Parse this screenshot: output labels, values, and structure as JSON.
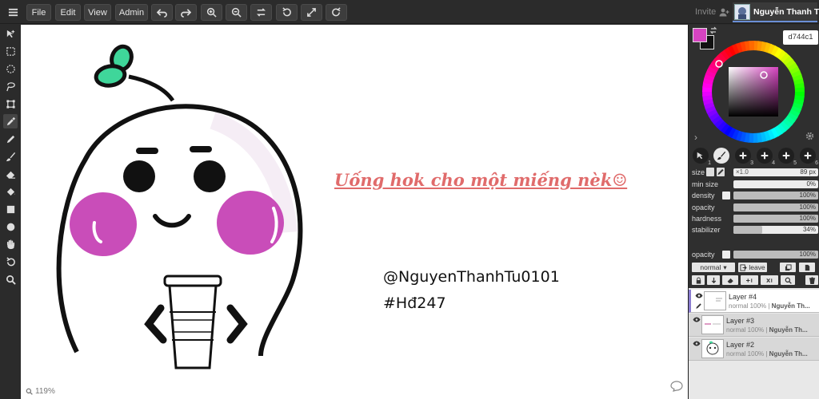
{
  "toolbar": {
    "file": "File",
    "edit": "Edit",
    "view": "View",
    "admin": "Admin"
  },
  "session": {
    "invite": "Invite",
    "user_name": "Nguyễn Thanh Tú"
  },
  "canvas": {
    "caption": "Uống hok cho một miếng nèk☺",
    "handle": "@NguyenThanhTu0101",
    "hashtag": "#Hđ247",
    "zoom": "119%",
    "colors": {
      "caption": "#e06b6b",
      "cheeks": "#c33ab1",
      "leaf": "#3fd69a"
    }
  },
  "color": {
    "primary": "#d744c1",
    "secondary": "#111111",
    "hex_label": "d744c1"
  },
  "brush_slots": [
    "1",
    "2",
    "3",
    "4",
    "5",
    "6"
  ],
  "brush": {
    "size_label": "size",
    "size_mult": "×1.0",
    "size_value": "89 px",
    "min_size_label": "min size",
    "min_size_value": "0%",
    "min_size_level": 0,
    "density_label": "density",
    "density_value": "100%",
    "density_level": 100,
    "opacity_label": "opacity",
    "opacity_value": "100%",
    "opacity_level": 100,
    "hardness_label": "hardness",
    "hardness_value": "100%",
    "hardness_level": 100,
    "stabilizer_label": "stabilizer",
    "stabilizer_value": "34%",
    "stabilizer_level": 34
  },
  "layer_controls": {
    "opacity_label": "opacity",
    "opacity_value": "100%",
    "opacity_level": 100,
    "blend_mode": "normal",
    "leave_label": "leave"
  },
  "layers": [
    {
      "name": "Layer #4",
      "mode": "normal 100%",
      "owner": "Nguyễn Th..."
    },
    {
      "name": "Layer #3",
      "mode": "normal 100%",
      "owner": "Nguyễn Th..."
    },
    {
      "name": "Layer #2",
      "mode": "normal 100%",
      "owner": "Nguyễn Th..."
    }
  ]
}
